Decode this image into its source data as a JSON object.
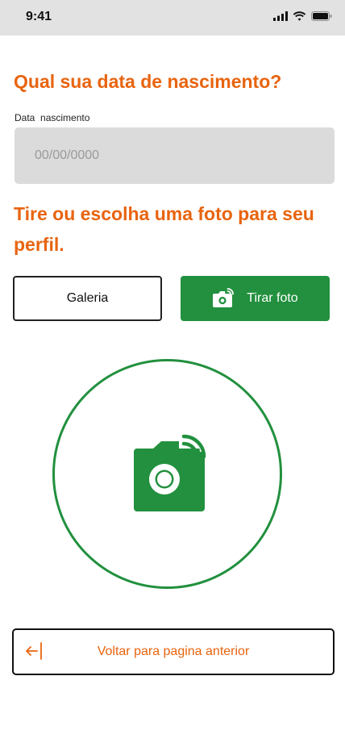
{
  "status_bar": {
    "time": "9:41"
  },
  "birth_date": {
    "question": "Qual sua data de nascimento?",
    "field_label": "Data  nascimento",
    "placeholder": "00/00/0000"
  },
  "photo": {
    "question": "Tire ou escolha uma foto para seu perfil.",
    "gallery_label": "Galeria",
    "take_photo_label": "Tirar foto"
  },
  "navigation": {
    "back_label": "Voltar para pagina anterior"
  },
  "colors": {
    "accent_orange": "#e8640f",
    "primary_green": "#22903e",
    "input_background": "#dbdbdb",
    "status_bar_background": "#e2e2e2"
  },
  "icons": {
    "signal": "cellular-signal-icon",
    "wifi": "wifi-icon",
    "battery": "battery-icon",
    "camera": "camera-icon",
    "back": "arrow-left-icon"
  }
}
